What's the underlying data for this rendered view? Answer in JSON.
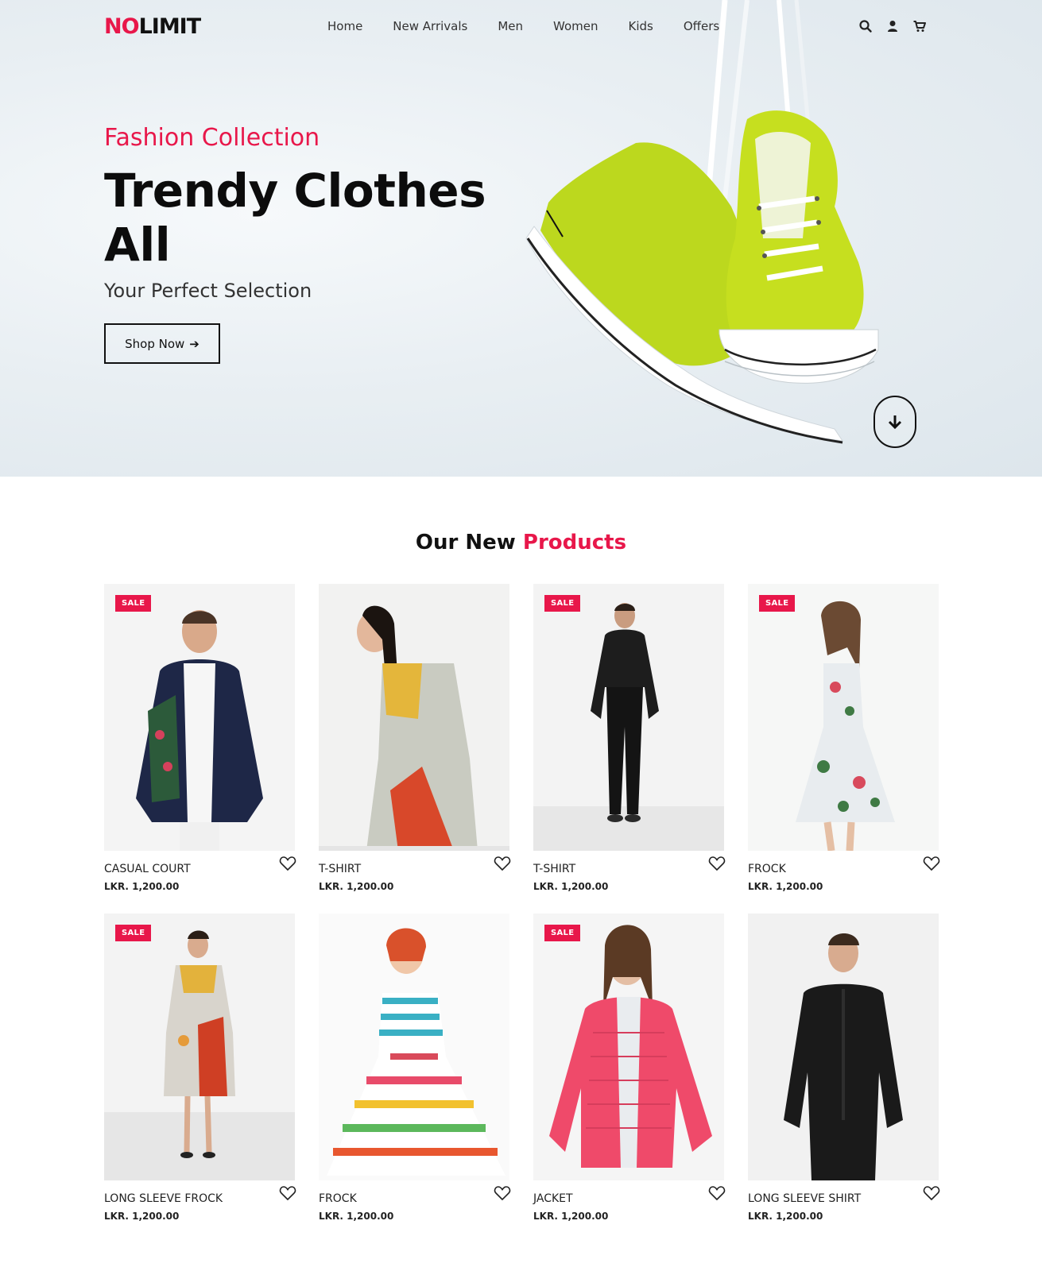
{
  "brand": {
    "part1": "NO",
    "part2": "LIMIT"
  },
  "nav": {
    "items": [
      "Home",
      "New Arrivals",
      "Men",
      "Women",
      "Kids",
      "Offers"
    ],
    "icons": [
      "search-icon",
      "user-icon",
      "cart-icon"
    ]
  },
  "hero": {
    "subtitle": "Fashion Collection",
    "title": "Trendy Clothes All",
    "tagline": "Your Perfect Selection",
    "button_label": "Shop Now",
    "shoe_color": "#b8d81c"
  },
  "products_section": {
    "title_part1": "Our New",
    "title_part2": "Products"
  },
  "colors": {
    "accent": "#e8174a",
    "text": "#111111"
  },
  "products": [
    {
      "name": "CASUAL COURT",
      "price": "LKR. 1,200.00",
      "sale": "SALE"
    },
    {
      "name": "T-SHIRT",
      "price": "LKR. 1,200.00",
      "sale": ""
    },
    {
      "name": "T-SHIRT",
      "price": "LKR. 1,200.00",
      "sale": "SALE"
    },
    {
      "name": "FROCK",
      "price": "LKR. 1,200.00",
      "sale": "SALE"
    },
    {
      "name": "LONG SLEEVE FROCK",
      "price": "LKR. 1,200.00",
      "sale": "SALE"
    },
    {
      "name": "FROCK",
      "price": "LKR. 1,200.00",
      "sale": ""
    },
    {
      "name": "JACKET",
      "price": "LKR. 1,200.00",
      "sale": "SALE"
    },
    {
      "name": "LONG SLEEVE SHIRT",
      "price": "LKR. 1,200.00",
      "sale": ""
    }
  ]
}
